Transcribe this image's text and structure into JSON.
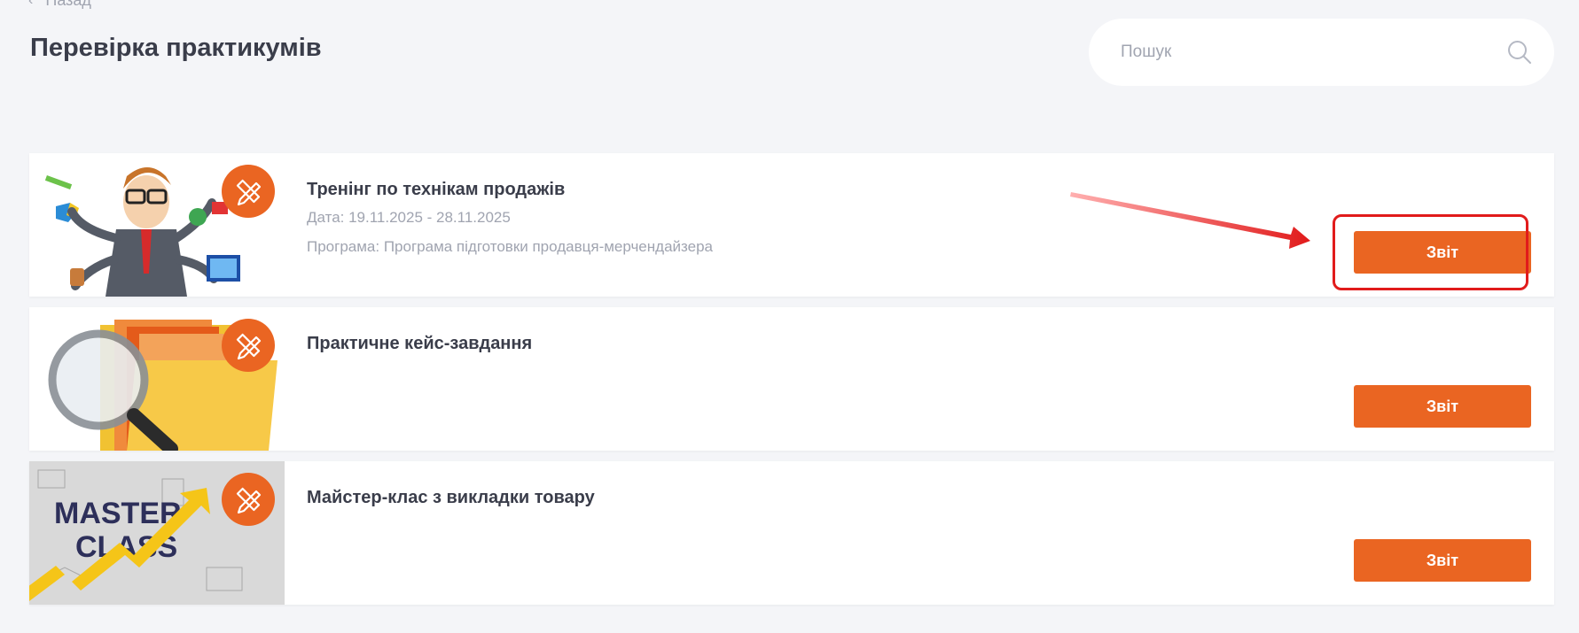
{
  "nav": {
    "back_label": "Назад"
  },
  "page": {
    "title": "Перевірка практикумів"
  },
  "search": {
    "placeholder": "Пошук",
    "icon": "search-icon"
  },
  "cards": [
    {
      "title": "Тренінг по технікам продажів",
      "date": "Дата: 19.11.2025 - 28.11.2025",
      "program": "Програма: Програма підготовки продавця-мерчендайзера",
      "button_label": "Звіт",
      "badge_icon": "pencil-ruler-icon",
      "image": "multitasking-businessman-illustration"
    },
    {
      "title": "Практичне кейс-завдання",
      "button_label": "Звіт",
      "badge_icon": "pencil-ruler-icon",
      "image": "folder-magnifier-illustration"
    },
    {
      "title": "Майстер-клас з викладки товару",
      "button_label": "Звіт",
      "badge_icon": "pencil-ruler-icon",
      "image": "master-class-illustration",
      "image_text": [
        "MASTER",
        "CLASS"
      ]
    }
  ],
  "colors": {
    "accent": "#ea6522",
    "background": "#f4f5f8",
    "annotation": "#e11b1b"
  }
}
